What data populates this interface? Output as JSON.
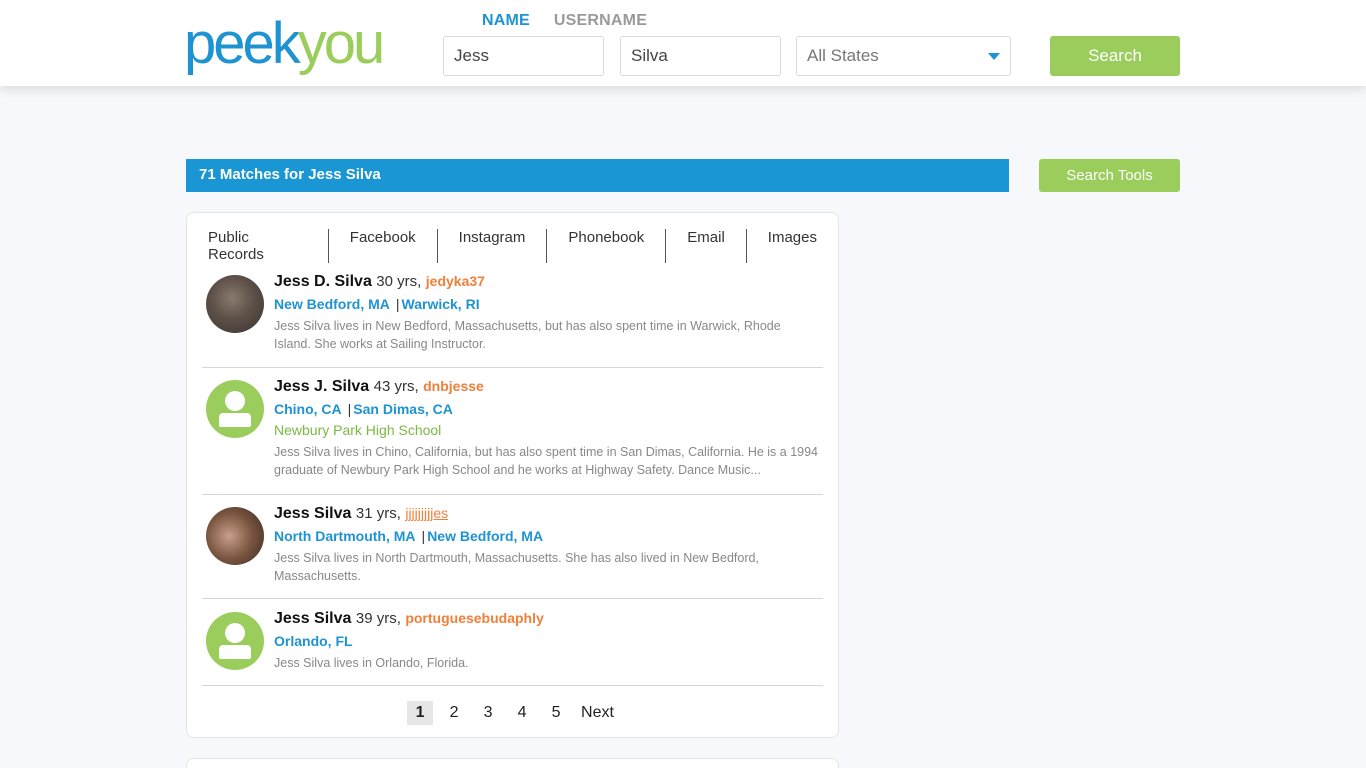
{
  "header": {
    "logo": {
      "part1": "peek",
      "part2": "you"
    },
    "tabs": [
      {
        "label": "NAME",
        "active": true
      },
      {
        "label": "USERNAME",
        "active": false
      }
    ],
    "first_name_value": "Jess",
    "last_name_value": "Silva",
    "state_select": "All States",
    "search_label": "Search"
  },
  "results_header": {
    "matches_text": "71 Matches for Jess Silva",
    "search_tools_label": "Search Tools"
  },
  "filters": [
    "Public Records",
    "Facebook",
    "Instagram",
    "Phonebook",
    "Email",
    "Images"
  ],
  "results": [
    {
      "name": "Jess D. Silva",
      "age": "30 yrs,",
      "username": "jedyka37",
      "locations": [
        "New Bedford, MA",
        "Warwick, RI"
      ],
      "school": "",
      "description": "Jess Silva lives in New Bedford, Massachusetts, but has also spent time in Warwick, Rhode Island. She works at Sailing Instructor."
    },
    {
      "name": "Jess J. Silva",
      "age": "43 yrs,",
      "username": "dnbjesse",
      "locations": [
        "Chino, CA",
        "San Dimas, CA"
      ],
      "school": "Newbury Park High School",
      "description": "Jess Silva lives in Chino, California, but has also spent time in San Dimas, California. He is a 1994 graduate of Newbury Park High School and he works at Highway Safety. Dance Music..."
    },
    {
      "name": "Jess Silva",
      "age": "31 yrs,",
      "username": "jjjjjjjjjes",
      "locations": [
        "North Dartmouth, MA",
        "New Bedford, MA"
      ],
      "school": "",
      "description": "Jess Silva lives in North Dartmouth, Massachusetts. She has also lived in New Bedford, Massachusetts."
    },
    {
      "name": "Jess Silva",
      "age": "39 yrs,",
      "username": "portuguesebudaphly",
      "locations": [
        "Orlando, FL"
      ],
      "school": "",
      "description": "Jess Silva lives in Orlando, Florida."
    }
  ],
  "pagination": {
    "pages": [
      "1",
      "2",
      "3",
      "4",
      "5"
    ],
    "current": "1",
    "next_label": "Next"
  },
  "colors": {
    "brand_blue": "#1e93d2",
    "brand_green": "#9acd5b",
    "username_orange": "#f07f3a"
  }
}
